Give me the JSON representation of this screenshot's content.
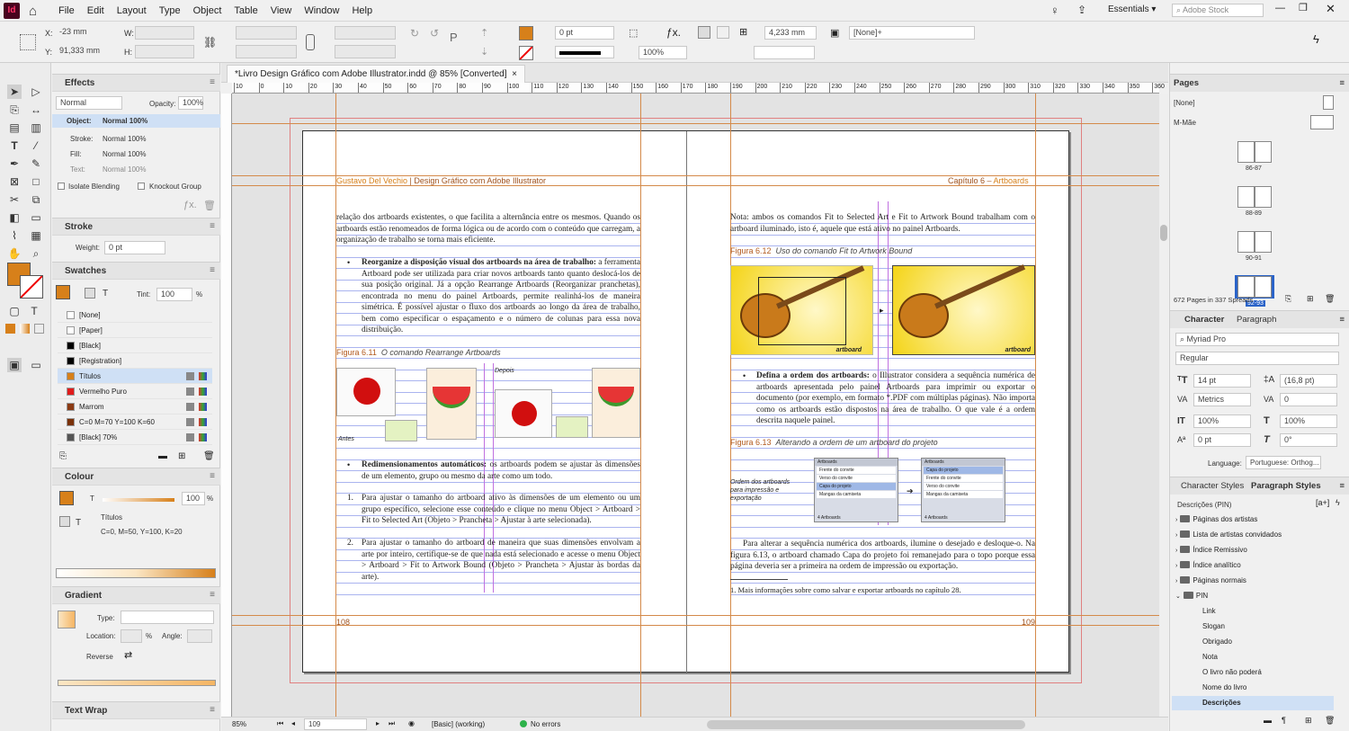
{
  "app": {
    "logo": "Id"
  },
  "menu": [
    "File",
    "Edit",
    "Layout",
    "Type",
    "Object",
    "Table",
    "View",
    "Window",
    "Help"
  ],
  "topright": {
    "workspace": "Essentials",
    "search_placeholder": "Adobe Stock"
  },
  "control": {
    "x_label": "X:",
    "x_value": "-23 mm",
    "y_label": "Y:",
    "y_value": "91,333 mm",
    "w_label": "W:",
    "h_label": "H:",
    "stroke_weight": "0 pt",
    "scale": "100%",
    "gutter": "4,233 mm",
    "style": "[None]+"
  },
  "effects": {
    "title": "Effects",
    "mode": "Normal",
    "opacity_label": "Opacity:",
    "opacity": "100%",
    "object_label": "Object:",
    "object_value": "Normal 100%",
    "stroke_label": "Stroke:",
    "stroke_value": "Normal 100%",
    "fill_label": "Fill:",
    "fill_value": "Normal 100%",
    "text_label": "Text:",
    "text_value": "Normal 100%",
    "isolate": "Isolate Blending",
    "knockout": "Knockout Group"
  },
  "stroke": {
    "title": "Stroke",
    "weight_label": "Weight:",
    "weight": "0 pt"
  },
  "swatches": {
    "title": "Swatches",
    "tint_label": "Tint:",
    "tint": "100",
    "pct": "%",
    "items": [
      {
        "name": "[None]",
        "color": "#ffffff"
      },
      {
        "name": "[Paper]",
        "color": "#ffffff"
      },
      {
        "name": "[Black]",
        "color": "#000000"
      },
      {
        "name": "[Registration]",
        "color": "#000000"
      },
      {
        "name": "Títulos",
        "color": "#d7801a"
      },
      {
        "name": "Vermelho Puro",
        "color": "#e01b1b"
      },
      {
        "name": "Marrom",
        "color": "#8b3a13"
      },
      {
        "name": "C=0 M=70 Y=100 K=60",
        "color": "#7a3108"
      },
      {
        "name": "[Black] 70%",
        "color": "#555555"
      }
    ]
  },
  "colour": {
    "title": "Colour",
    "value": "100",
    "pct": "%",
    "name": "Títulos",
    "cmyk": "C=0, M=50, Y=100, K=20"
  },
  "gradient": {
    "title": "Gradient",
    "type_label": "Type:",
    "location_label": "Location:",
    "angle_label": "Angle:",
    "pct": "%",
    "reverse_label": "Reverse"
  },
  "textwrap": {
    "title": "Text Wrap"
  },
  "tab": {
    "title": "*Livro Design Gráfico com Adobe Illustrator.indd @ 85% [Converted]",
    "close": "×"
  },
  "ruler_ticks": [
    "10",
    "0",
    "10",
    "20",
    "30",
    "40",
    "50",
    "60",
    "70",
    "80",
    "90",
    "100",
    "110",
    "120",
    "130",
    "140",
    "150",
    "160",
    "170",
    "180",
    "190",
    "200",
    "210",
    "220",
    "230",
    "240",
    "250",
    "260",
    "270",
    "280",
    "290",
    "300",
    "310",
    "320",
    "330",
    "340",
    "350",
    "360",
    "370"
  ],
  "left_page": {
    "header_author": "Gustavo Del Vechio",
    "header_title": " | Design Gráfico com Adobe Illustrator",
    "para1": "relação dos artboards existentes, o que facilita a alternância entre os mesmos. Quando os artboards estão renomeados de forma lógica ou de acordo com o conteúdo que carregam, a organização de trabalho se torna mais eficiente.",
    "bullet1_bold": "Reorganize a disposição visual dos artboards na área de trabalho:",
    "bullet1": " a ferramenta Artboard pode ser utilizada para criar novos artboards tanto quanto deslocá-los de sua posição original. Já a opção Rearrange Artboards (Reorganizar pranchetas), encontrada no menu do painel Artboards, permite realinhá-los de maneira simétrica. É possível ajustar o fluxo dos artboards ao longo da área de trabalho, bem como especificar o espaçamento e o número de colunas para essa nova distribuição.",
    "fig_num": "Figura 6.11",
    "fig_caption": "O comando Rearrange Artboards",
    "antes": "Antes",
    "depois": "Depois",
    "bullet2_bold": "Redimensionamentos automáticos:",
    "bullet2": " os artboards podem se ajustar às dimensões de um elemento, grupo ou mesmo da arte como um todo.",
    "item1": "Para ajustar o tamanho do artboard ativo às dimensões de um elemento ou um grupo específico, selecione esse conteúdo e clique no menu Object > Artboard > Fit to Selected Art (Objeto > Prancheta > Ajustar à arte selecionada).",
    "item2": "Para ajustar o tamanho do artboard de maneira que suas dimensões envolvam a arte por inteiro, certifique-se de que nada está selecionado e acesse o menu Object > Artboard > Fit to Artwork Bound (Objeto > Prancheta > Ajustar às bordas da arte).",
    "n1": "1.",
    "n2": "2.",
    "page_no": "108"
  },
  "right_page": {
    "header_chapter": "Capítulo 6 – ",
    "header_topic": "Artboards",
    "note": "Nota: ambos os comandos Fit to Selected Art e Fit to Artwork Bound trabalham com o artboard iluminado, isto é, aquele que está ativo no painel Artboards.",
    "fig12_num": "Figura 6.12",
    "fig12_caption": "Uso do comando Fit to Artwork Bound",
    "artboard_label": "artboard",
    "bullet_bold": "Defina a ordem dos artboards:",
    "bullet": " o Illustrator considera a sequência numérica de artboards apresentada pelo painel Artboards para imprimir ou exportar o documento (por exemplo, em formato *.PDF com múltiplas páginas). Não importa como os artboards estão dispostos na área de trabalho. O que vale é a ordem descrita naquele painel.",
    "fig13_num": "Figura 6.13",
    "fig13_caption": "Alterando a ordem de um artboard do projeto",
    "fig13_note": "Ordem dos artboards para impressão e exportação",
    "panel_title": "Artboards",
    "panel_rows_before": [
      "Frente do convite",
      "Verso do convite",
      "Capa do projeto",
      "Mangas da camiseta"
    ],
    "panel_rows_after": [
      "Capa do projeto",
      "Frente do convite",
      "Verso do convite",
      "Mangas da camiseta"
    ],
    "panel_footer": "4 Artboards",
    "para": "Para alterar a sequência numérica dos artboards, ilumine o desejado e desloque-o. Na figura 6.13, o artboard chamado Capa do projeto foi remanejado para o topo porque essa página deveria ser a primeira na ordem de impressão ou exportação.",
    "footnote": "1. Mais informações sobre como salvar e exportar artboards no capítulo 28.",
    "page_no": "109"
  },
  "statusbar": {
    "zoom": "85%",
    "page": "109",
    "style": "[Basic] (working)",
    "errors": "No errors"
  },
  "pages": {
    "title": "Pages",
    "none": "[None]",
    "master": "M-Mãe",
    "spreads": [
      "86-87",
      "88-89",
      "90-91",
      "92-93"
    ],
    "count": "672 Pages in 337 Spreads"
  },
  "character": {
    "tab1": "Character",
    "tab2": "Paragraph",
    "font": "Myriad Pro",
    "style": "Regular",
    "size": "14 pt",
    "leading": "(16,8 pt)",
    "kerning": "Metrics",
    "tracking": "0",
    "vscale": "100%",
    "hscale": "100%",
    "baseline": "0 pt",
    "skew": "0°",
    "language_label": "Language:",
    "language": "Portuguese: Orthog..."
  },
  "paragraph_styles": {
    "tab1": "Character Styles",
    "tab2": "Paragraph Styles",
    "current": "Descrições (PIN)",
    "items": [
      {
        "name": "Páginas dos artistas",
        "type": "folder",
        "indent": 0
      },
      {
        "name": "Lista de artistas convidados",
        "type": "folder",
        "indent": 0
      },
      {
        "name": "Índice Remissivo",
        "type": "folder",
        "indent": 0
      },
      {
        "name": "Índice analítico",
        "type": "folder",
        "indent": 0
      },
      {
        "name": "Páginas normais",
        "type": "folder",
        "indent": 0
      },
      {
        "name": "PIN",
        "type": "folder-open",
        "indent": 0
      },
      {
        "name": "Link",
        "type": "style",
        "indent": 1
      },
      {
        "name": "Slogan",
        "type": "style",
        "indent": 1
      },
      {
        "name": "Obrigado",
        "type": "style",
        "indent": 1
      },
      {
        "name": "Nota",
        "type": "style",
        "indent": 1
      },
      {
        "name": "O livro não poderá",
        "type": "style",
        "indent": 1
      },
      {
        "name": "Nome do livro",
        "type": "style",
        "indent": 1
      },
      {
        "name": "Descrições",
        "type": "style-selected",
        "indent": 1
      }
    ]
  },
  "colors": {
    "accent": "#d7801a",
    "guide": "#d48a4a",
    "bleed": "#e08080",
    "selection": "#cfe0f5"
  }
}
